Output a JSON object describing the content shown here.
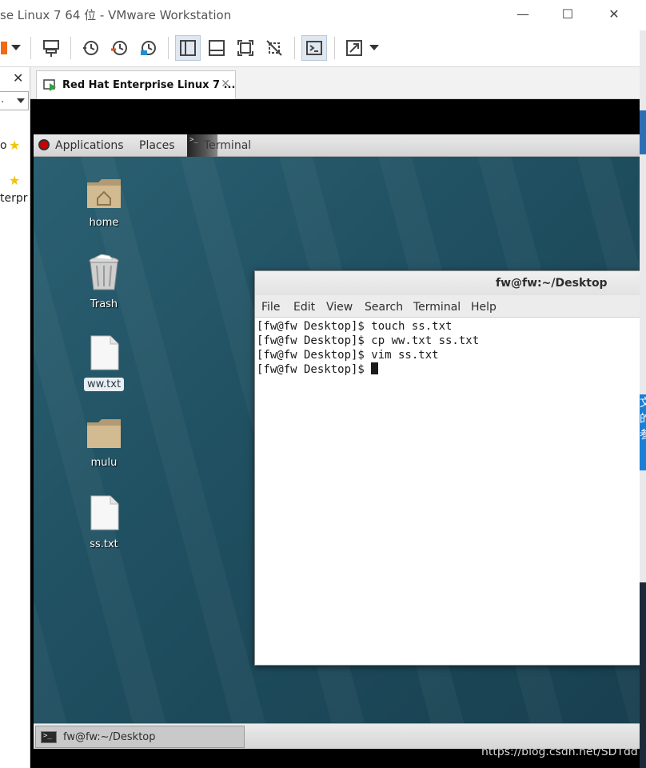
{
  "window": {
    "title": "se Linux 7 64 位 - VMware Workstation",
    "minimize": "—",
    "maximize": "☐",
    "close": "✕"
  },
  "library": {
    "close": "✕",
    "search_value": ".",
    "items": [
      {
        "label": "o"
      },
      {
        "label": "terpr"
      }
    ]
  },
  "tab": {
    "label": "Red Hat Enterprise Linux 7 ...",
    "close": "✕"
  },
  "gnome": {
    "applications": "Applications",
    "places": "Places",
    "terminal": "Terminal",
    "terminal_glyph": ">_"
  },
  "desktop_icons": [
    {
      "label": "home"
    },
    {
      "label": "Trash"
    },
    {
      "label": "ww.txt"
    },
    {
      "label": "mulu"
    },
    {
      "label": "ss.txt"
    }
  ],
  "terminal": {
    "title": "fw@fw:~/Desktop",
    "menu": [
      "File",
      "Edit",
      "View",
      "Search",
      "Terminal",
      "Help"
    ],
    "lines": [
      "[fw@fw Desktop]$ touch ss.txt",
      "[fw@fw Desktop]$ cp ww.txt ss.txt",
      "[fw@fw Desktop]$ vim ss.txt",
      "[fw@fw Desktop]$ "
    ]
  },
  "taskbar": {
    "item_label": "fw@fw:~/Desktop",
    "item_glyph": ">_"
  },
  "watermark": "https://blog.csdn.net/SDTdd",
  "host_edge_text": "文的参"
}
